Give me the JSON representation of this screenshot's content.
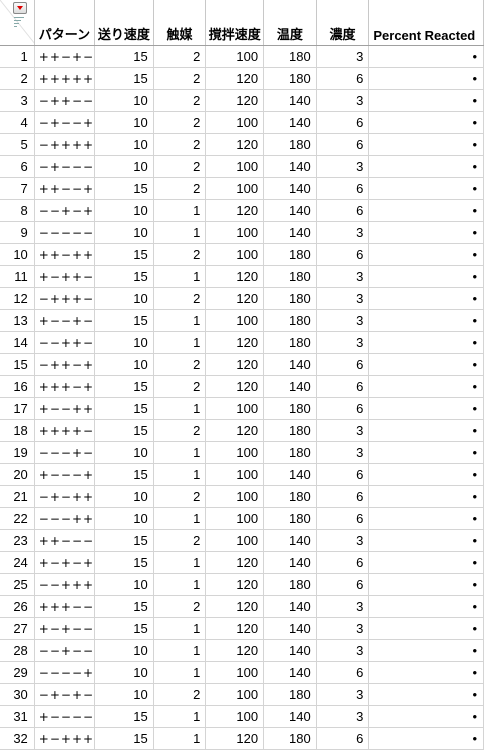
{
  "columns": {
    "pattern": "パターン",
    "feed": "送り速度",
    "catalyst": "触媒",
    "stir": "撹拌速度",
    "temp": "温度",
    "conc": "濃度",
    "response": "Percent Reacted"
  },
  "corner": {
    "menu_icon": "red-triangle-menu-icon",
    "filter_icon": "row-filter-icon"
  },
  "rows": [
    {
      "n": "1",
      "pattern": "++−+−",
      "feed": "15",
      "catalyst": "2",
      "stir": "100",
      "temp": "180",
      "conc": "3",
      "response": "•"
    },
    {
      "n": "2",
      "pattern": "+++++",
      "feed": "15",
      "catalyst": "2",
      "stir": "120",
      "temp": "180",
      "conc": "6",
      "response": "•"
    },
    {
      "n": "3",
      "pattern": "−++−−",
      "feed": "10",
      "catalyst": "2",
      "stir": "120",
      "temp": "140",
      "conc": "3",
      "response": "•"
    },
    {
      "n": "4",
      "pattern": "−+−−+",
      "feed": "10",
      "catalyst": "2",
      "stir": "100",
      "temp": "140",
      "conc": "6",
      "response": "•"
    },
    {
      "n": "5",
      "pattern": "−++++",
      "feed": "10",
      "catalyst": "2",
      "stir": "120",
      "temp": "180",
      "conc": "6",
      "response": "•"
    },
    {
      "n": "6",
      "pattern": "−+−−−",
      "feed": "10",
      "catalyst": "2",
      "stir": "100",
      "temp": "140",
      "conc": "3",
      "response": "•"
    },
    {
      "n": "7",
      "pattern": "++−−+",
      "feed": "15",
      "catalyst": "2",
      "stir": "100",
      "temp": "140",
      "conc": "6",
      "response": "•"
    },
    {
      "n": "8",
      "pattern": "−−+−+",
      "feed": "10",
      "catalyst": "1",
      "stir": "120",
      "temp": "140",
      "conc": "6",
      "response": "•"
    },
    {
      "n": "9",
      "pattern": "−−−−−",
      "feed": "10",
      "catalyst": "1",
      "stir": "100",
      "temp": "140",
      "conc": "3",
      "response": "•"
    },
    {
      "n": "10",
      "pattern": "++−++",
      "feed": "15",
      "catalyst": "2",
      "stir": "100",
      "temp": "180",
      "conc": "6",
      "response": "•"
    },
    {
      "n": "11",
      "pattern": "+−++−",
      "feed": "15",
      "catalyst": "1",
      "stir": "120",
      "temp": "180",
      "conc": "3",
      "response": "•"
    },
    {
      "n": "12",
      "pattern": "−+++−",
      "feed": "10",
      "catalyst": "2",
      "stir": "120",
      "temp": "180",
      "conc": "3",
      "response": "•"
    },
    {
      "n": "13",
      "pattern": "+−−+−",
      "feed": "15",
      "catalyst": "1",
      "stir": "100",
      "temp": "180",
      "conc": "3",
      "response": "•"
    },
    {
      "n": "14",
      "pattern": "−−++−",
      "feed": "10",
      "catalyst": "1",
      "stir": "120",
      "temp": "180",
      "conc": "3",
      "response": "•"
    },
    {
      "n": "15",
      "pattern": "−++−+",
      "feed": "10",
      "catalyst": "2",
      "stir": "120",
      "temp": "140",
      "conc": "6",
      "response": "•"
    },
    {
      "n": "16",
      "pattern": "+++−+",
      "feed": "15",
      "catalyst": "2",
      "stir": "120",
      "temp": "140",
      "conc": "6",
      "response": "•"
    },
    {
      "n": "17",
      "pattern": "+−−++",
      "feed": "15",
      "catalyst": "1",
      "stir": "100",
      "temp": "180",
      "conc": "6",
      "response": "•"
    },
    {
      "n": "18",
      "pattern": "++++−",
      "feed": "15",
      "catalyst": "2",
      "stir": "120",
      "temp": "180",
      "conc": "3",
      "response": "•"
    },
    {
      "n": "19",
      "pattern": "−−−+−",
      "feed": "10",
      "catalyst": "1",
      "stir": "100",
      "temp": "180",
      "conc": "3",
      "response": "•"
    },
    {
      "n": "20",
      "pattern": "+−−−+",
      "feed": "15",
      "catalyst": "1",
      "stir": "100",
      "temp": "140",
      "conc": "6",
      "response": "•"
    },
    {
      "n": "21",
      "pattern": "−+−++",
      "feed": "10",
      "catalyst": "2",
      "stir": "100",
      "temp": "180",
      "conc": "6",
      "response": "•"
    },
    {
      "n": "22",
      "pattern": "−−−++",
      "feed": "10",
      "catalyst": "1",
      "stir": "100",
      "temp": "180",
      "conc": "6",
      "response": "•"
    },
    {
      "n": "23",
      "pattern": "++−−−",
      "feed": "15",
      "catalyst": "2",
      "stir": "100",
      "temp": "140",
      "conc": "3",
      "response": "•"
    },
    {
      "n": "24",
      "pattern": "+−+−+",
      "feed": "15",
      "catalyst": "1",
      "stir": "120",
      "temp": "140",
      "conc": "6",
      "response": "•"
    },
    {
      "n": "25",
      "pattern": "−−+++",
      "feed": "10",
      "catalyst": "1",
      "stir": "120",
      "temp": "180",
      "conc": "6",
      "response": "•"
    },
    {
      "n": "26",
      "pattern": "+++−−",
      "feed": "15",
      "catalyst": "2",
      "stir": "120",
      "temp": "140",
      "conc": "3",
      "response": "•"
    },
    {
      "n": "27",
      "pattern": "+−+−−",
      "feed": "15",
      "catalyst": "1",
      "stir": "120",
      "temp": "140",
      "conc": "3",
      "response": "•"
    },
    {
      "n": "28",
      "pattern": "−−+−−",
      "feed": "10",
      "catalyst": "1",
      "stir": "120",
      "temp": "140",
      "conc": "3",
      "response": "•"
    },
    {
      "n": "29",
      "pattern": "−−−−+",
      "feed": "10",
      "catalyst": "1",
      "stir": "100",
      "temp": "140",
      "conc": "6",
      "response": "•"
    },
    {
      "n": "30",
      "pattern": "−+−+−",
      "feed": "10",
      "catalyst": "2",
      "stir": "100",
      "temp": "180",
      "conc": "3",
      "response": "•"
    },
    {
      "n": "31",
      "pattern": "+−−−−",
      "feed": "15",
      "catalyst": "1",
      "stir": "100",
      "temp": "140",
      "conc": "3",
      "response": "•"
    },
    {
      "n": "32",
      "pattern": "+−+++",
      "feed": "15",
      "catalyst": "1",
      "stir": "120",
      "temp": "180",
      "conc": "6",
      "response": "•"
    }
  ]
}
